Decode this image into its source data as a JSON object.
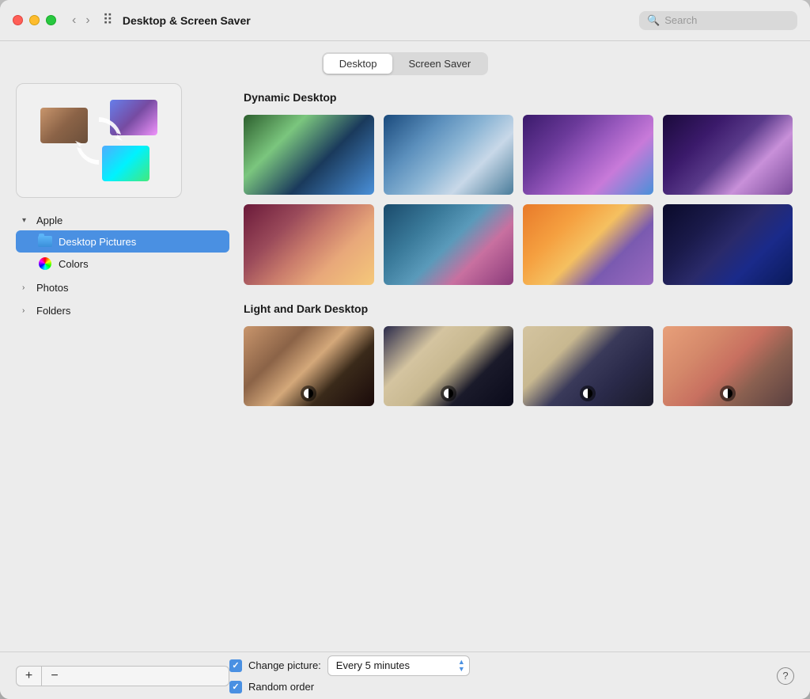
{
  "window": {
    "title": "Desktop & Screen Saver"
  },
  "titlebar": {
    "back_label": "‹",
    "forward_label": "›",
    "grid_label": "⠿",
    "title": "Desktop & Screen Saver",
    "search_placeholder": "Search"
  },
  "tabs": {
    "desktop_label": "Desktop",
    "screensaver_label": "Screen Saver"
  },
  "sidebar": {
    "apple_section": "Apple",
    "items": [
      {
        "label": "Desktop Pictures",
        "type": "folder"
      },
      {
        "label": "Colors",
        "type": "colors"
      }
    ],
    "photos_label": "Photos",
    "folders_label": "Folders",
    "add_label": "+",
    "remove_label": "−"
  },
  "wallpapers": {
    "section1_title": "Dynamic Desktop",
    "section2_title": "Light and Dark Desktop",
    "thumbs_dynamic": [
      "w1",
      "w2",
      "w3",
      "w4",
      "w5",
      "w6",
      "w7",
      "w8"
    ],
    "thumbs_lightdark": [
      "ld1",
      "ld2",
      "ld3",
      "ld4"
    ]
  },
  "bottom": {
    "change_picture_label": "Change picture:",
    "change_picture_checked": true,
    "random_order_label": "Random order",
    "random_order_checked": true,
    "interval_value": "Every 5 minutes",
    "help_label": "?"
  }
}
